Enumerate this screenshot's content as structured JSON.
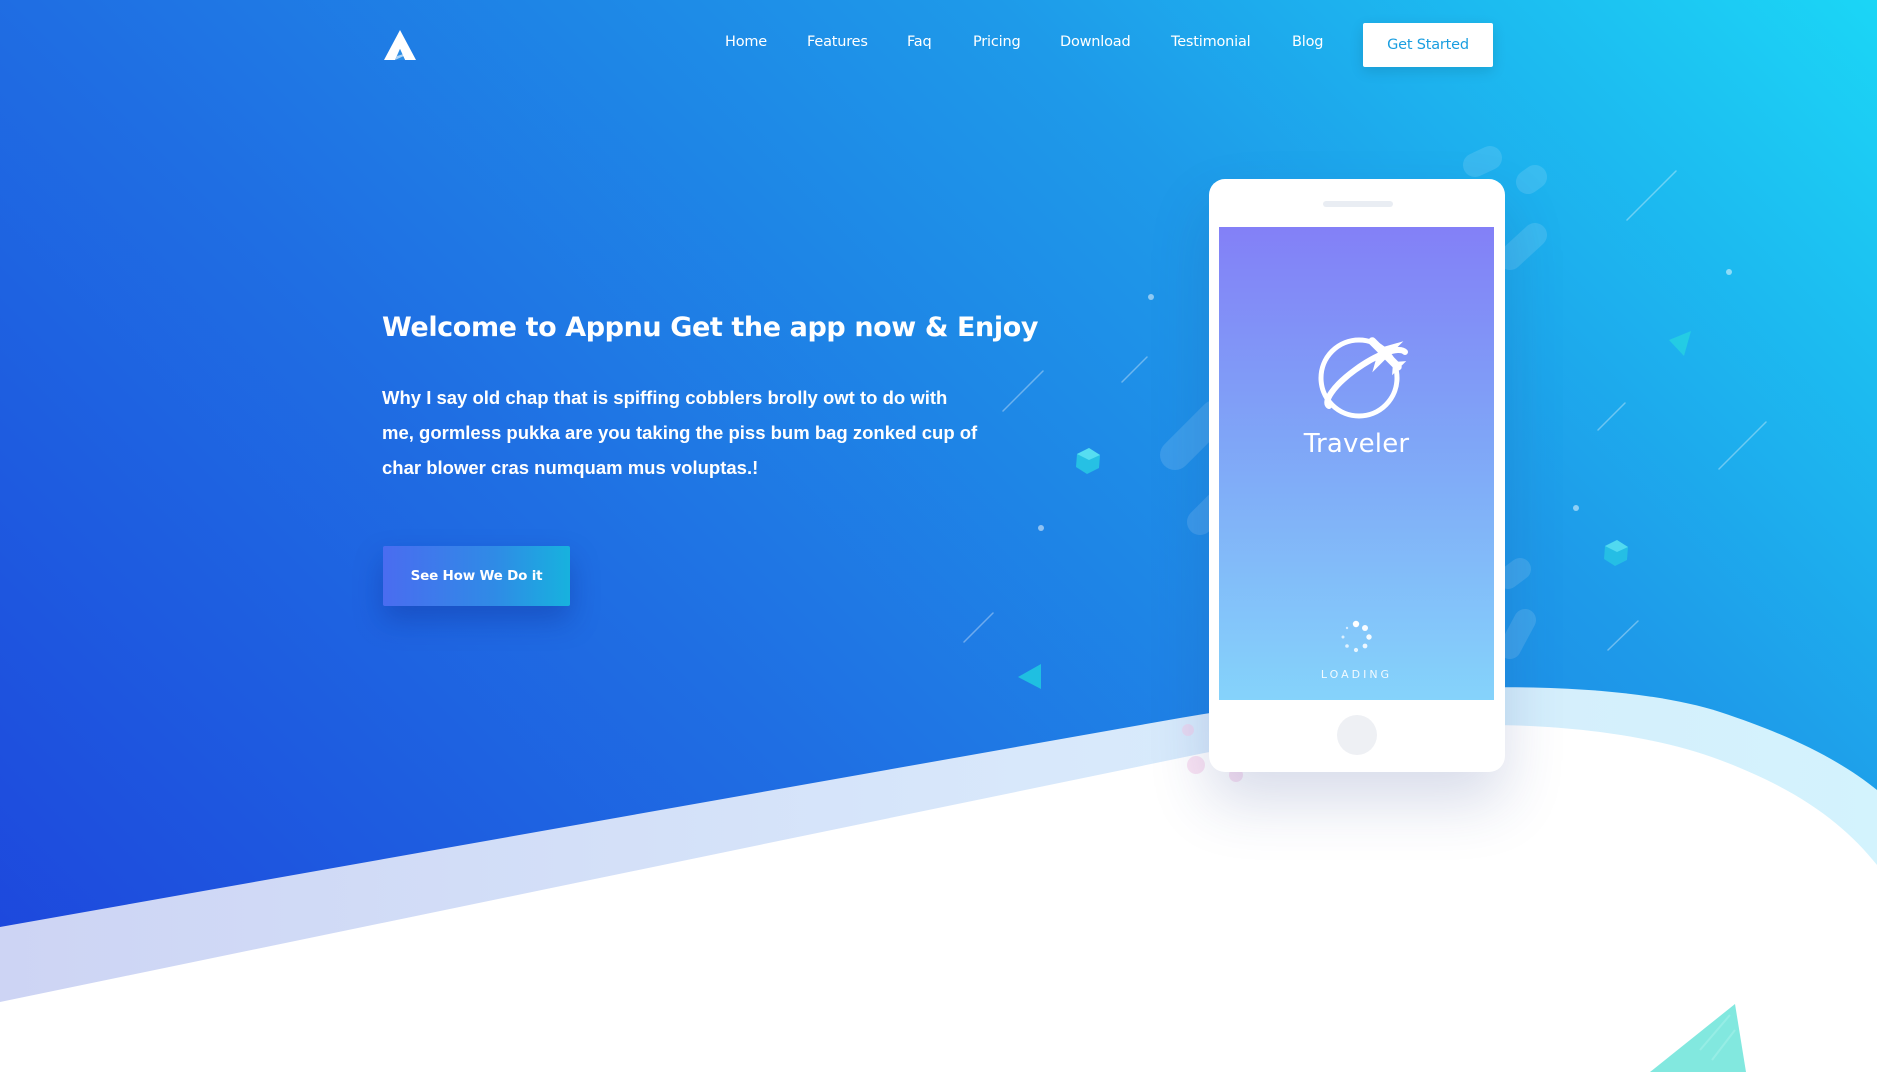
{
  "header": {
    "logo_icon": "appnu-logo-icon",
    "nav": [
      "Home",
      "Features",
      "Faq",
      "Pricing",
      "Download",
      "Testimonial",
      "Blog"
    ],
    "cta_label": "Get Started"
  },
  "hero": {
    "title": "Welcome to Appnu Get the app now & Enjoy",
    "description": "Why I say old chap that is spiffing cobblers brolly owt to do with me, gormless pukka are you taking the piss bum bag zonked cup of char blower cras numquam mus voluptas.!",
    "button_label": "See How We Do it"
  },
  "phone": {
    "app_icon": "airplane-globe-icon",
    "app_name": "Traveler",
    "loading_text": "LOADING",
    "spinner_icon": "loading-spinner-icon"
  },
  "colors": {
    "hero_gradient": [
      "#1bd6f6",
      "#1e9ae9",
      "#1f6fe3",
      "#1d43dc"
    ],
    "accent": "#1a9ee0",
    "screen_gradient": [
      "#8380f7",
      "#7fa5f7",
      "#85d3fb"
    ]
  }
}
